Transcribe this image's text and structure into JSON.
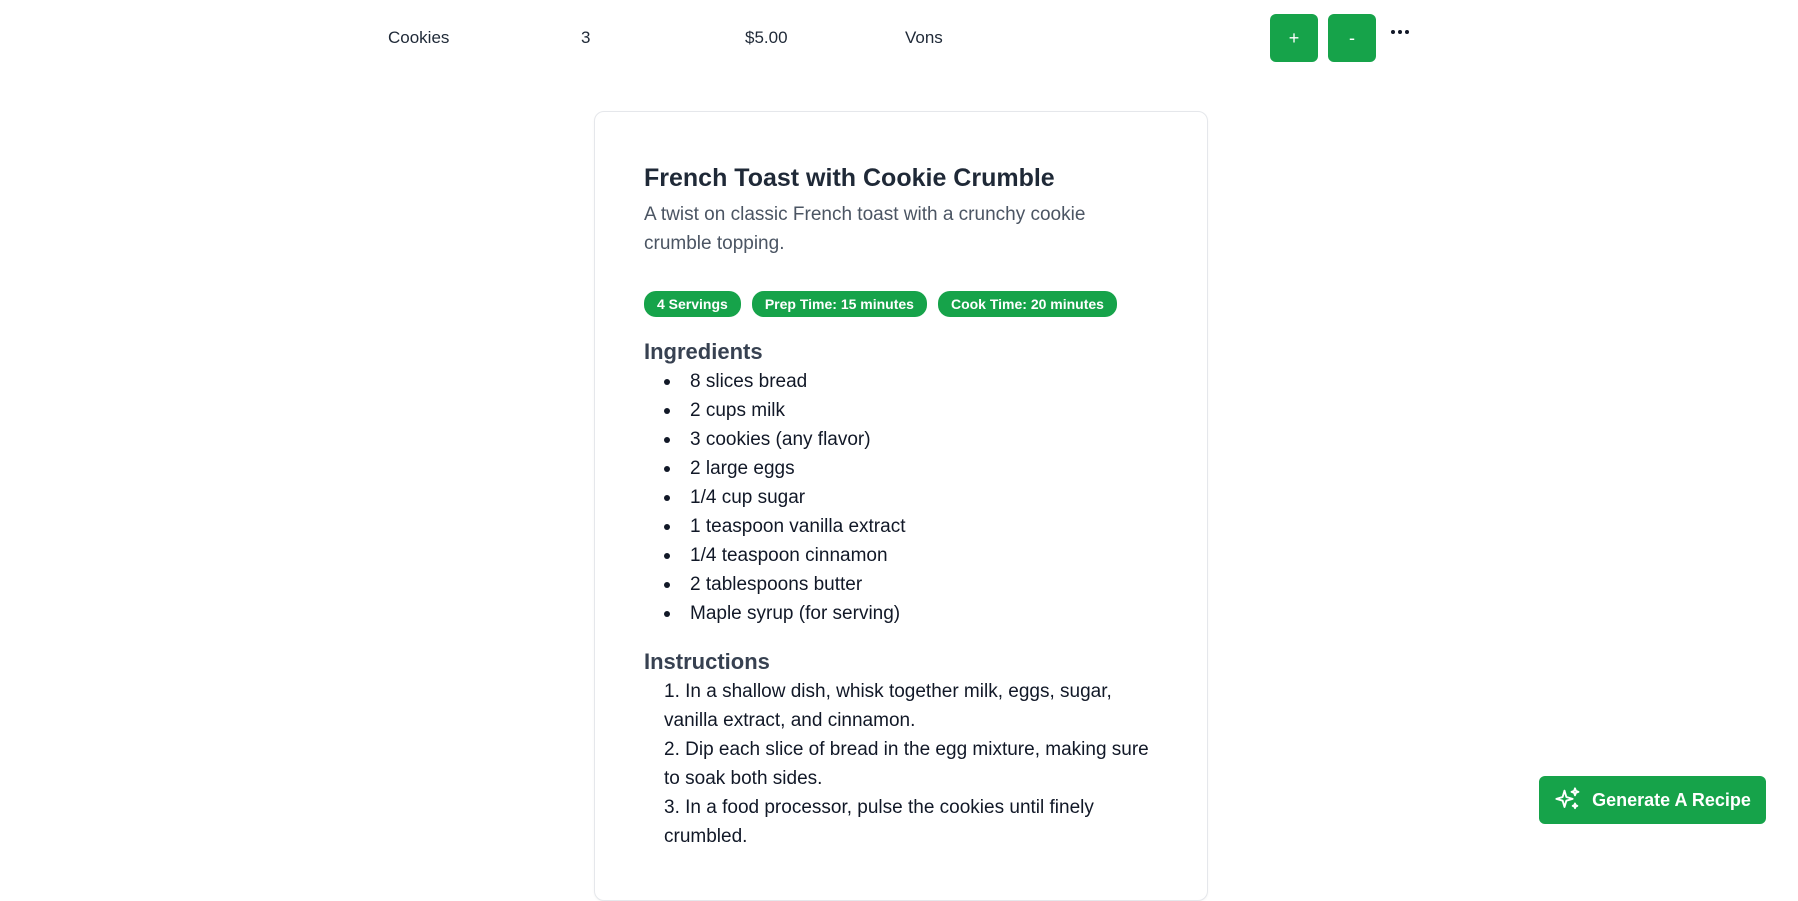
{
  "grocery_item": {
    "name": "Cookies",
    "quantity": "3",
    "price": "$5.00",
    "store": "Vons",
    "increment_label": "+",
    "decrement_label": "-"
  },
  "recipe": {
    "title": "French Toast with Cookie Crumble",
    "description": "A twist on classic French toast with a crunchy cookie crumble topping.",
    "badges": {
      "servings": "4 Servings",
      "prep_time": "Prep Time: 15 minutes",
      "cook_time": "Cook Time: 20 minutes"
    },
    "ingredients_title": "Ingredients",
    "ingredients": [
      "8 slices bread",
      "2 cups milk",
      "3 cookies (any flavor)",
      "2 large eggs",
      "1/4 cup sugar",
      "1 teaspoon vanilla extract",
      "1/4 teaspoon cinnamon",
      "2 tablespoons butter",
      "Maple syrup (for serving)"
    ],
    "instructions_title": "Instructions",
    "instructions": [
      "1. In a shallow dish, whisk together milk, eggs, sugar, vanilla extract, and cinnamon.",
      "2. Dip each slice of bread in the egg mixture, making sure to soak both sides.",
      "3. In a food processor, pulse the cookies until finely crumbled."
    ]
  },
  "generate_button": {
    "label": "Generate A Recipe",
    "icon": "sparkles-icon"
  },
  "colors": {
    "accent": "#16a34a"
  }
}
